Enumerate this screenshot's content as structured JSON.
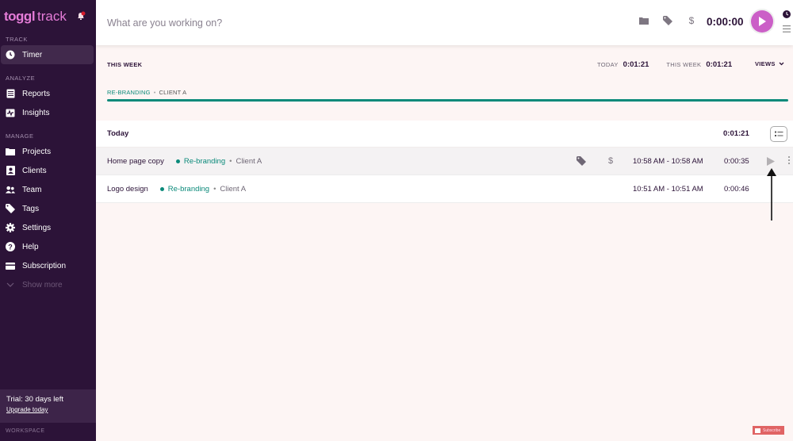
{
  "sidebar": {
    "brand": "toggl",
    "product": "track",
    "sections": {
      "track": "TRACK",
      "analyze": "ANALYZE",
      "manage": "MANAGE",
      "workspace": "WORKSPACE"
    },
    "items": {
      "timer": "Timer",
      "reports": "Reports",
      "insights": "Insights",
      "projects": "Projects",
      "clients": "Clients",
      "team": "Team",
      "tags": "Tags",
      "settings": "Settings",
      "help": "Help",
      "subscription": "Subscription",
      "show_more": "Show more"
    },
    "trial": {
      "text": "Trial: 30 days left",
      "link": "Upgrade today"
    }
  },
  "topbar": {
    "placeholder": "What are you working on?",
    "timer": "0:00:00",
    "icons": [
      "folder-icon",
      "tag-icon",
      "dollar-icon"
    ]
  },
  "week": {
    "title": "THIS WEEK",
    "today_label": "TODAY",
    "today_value": "0:01:21",
    "week_label": "THIS WEEK",
    "week_value": "0:01:21",
    "views_label": "VIEWS",
    "legend": {
      "project": "RE-BRANDING",
      "separator": "•",
      "client": "CLIENT A"
    },
    "progress_percent": 100,
    "project_color": "#0b8a7a"
  },
  "entries": {
    "group_title": "Today",
    "group_total": "0:01:21",
    "rows": [
      {
        "description": "Home page copy",
        "project": "Re-branding",
        "separator": "•",
        "client": "Client A",
        "range": "10:58 AM - 10:58 AM",
        "duration": "0:00:35"
      },
      {
        "description": "Logo design",
        "project": "Re-branding",
        "separator": "•",
        "client": "Client A",
        "range": "10:51 AM - 10:51 AM",
        "duration": "0:00:46"
      }
    ]
  },
  "overlay": {
    "youtube_badge": "Subscribe"
  },
  "colors": {
    "sidebar_bg": "#2c1338",
    "accent": "#cb5fc7",
    "project_green": "#0b8a7a"
  }
}
